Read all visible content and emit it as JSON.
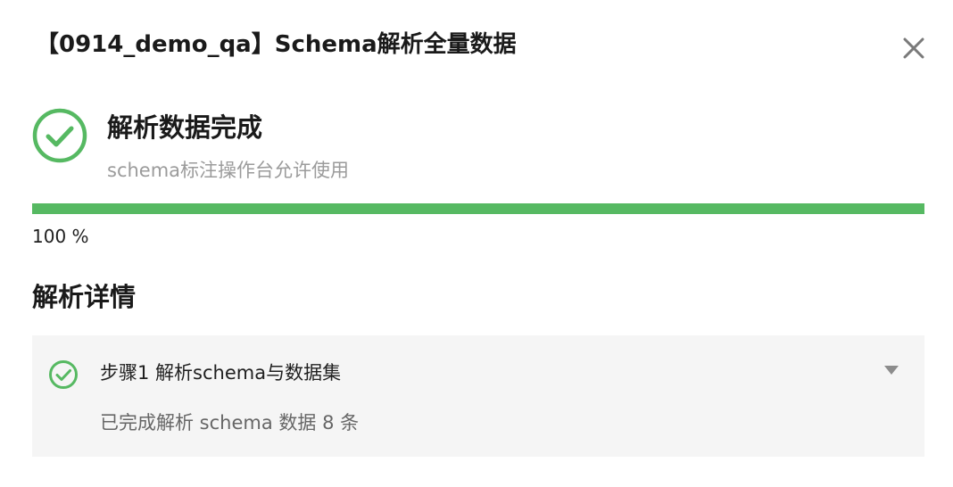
{
  "dialog": {
    "title": "【0914_demo_qa】Schema解析全量数据",
    "close_icon": "close-icon"
  },
  "status": {
    "icon": "check-circle-icon",
    "title": "解析数据完成",
    "subtitle": "schema标注操作台允许使用",
    "color": "#56b962"
  },
  "progress": {
    "value": 100,
    "label": "100 %",
    "fill_color": "#56b962",
    "track_color": "#e8e8e8"
  },
  "details": {
    "heading": "解析详情",
    "steps": [
      {
        "icon": "check-circle-icon",
        "title": "步骤1 解析schema与数据集",
        "description": "已完成解析 schema 数据 8 条",
        "expand_icon": "caret-down-icon"
      }
    ]
  }
}
